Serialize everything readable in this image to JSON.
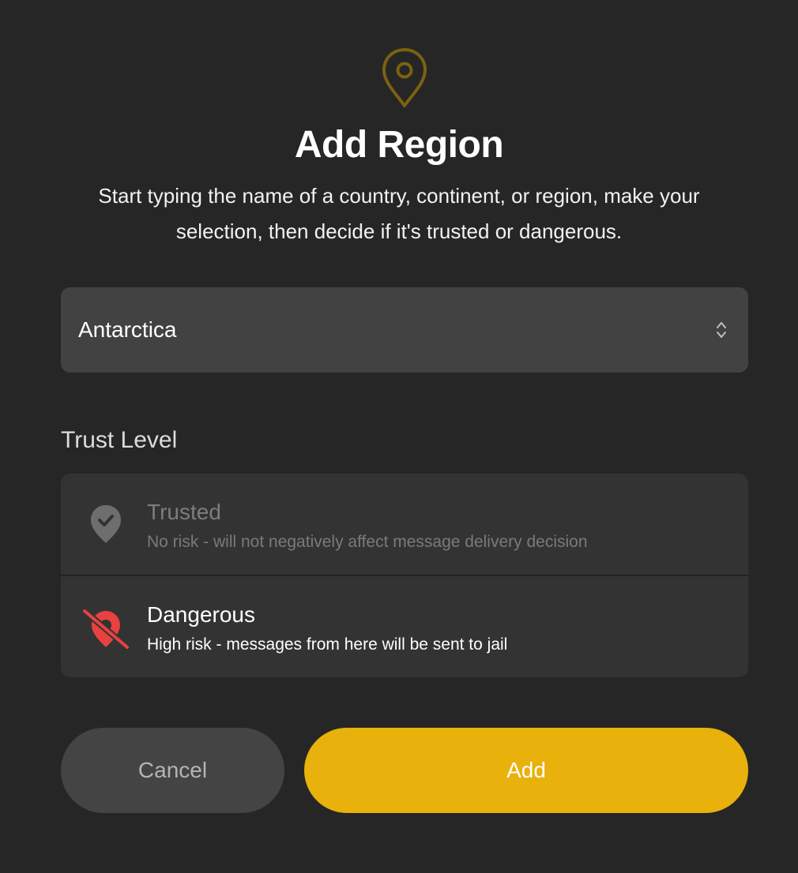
{
  "header": {
    "icon": "map-pin-icon",
    "title": "Add Region",
    "description": "Start typing the name of a country, continent, or region, make your selection, then decide if it's trusted or dangerous."
  },
  "region_select": {
    "value": "Antarctica",
    "icon": "chevron-up-down-icon"
  },
  "trust_level": {
    "label": "Trust Level",
    "selected": "Dangerous",
    "options": [
      {
        "title": "Trusted",
        "subtitle": "No risk - will not negatively affect message delivery decision",
        "icon": "location-check-icon"
      },
      {
        "title": "Dangerous",
        "subtitle": "High risk - messages from here will be sent to jail",
        "icon": "location-off-icon"
      }
    ]
  },
  "actions": {
    "cancel_label": "Cancel",
    "add_label": "Add"
  },
  "colors": {
    "background": "#262626",
    "accent": "#e8b10c",
    "danger": "#e8413f",
    "pin_outline": "#8a6d10"
  }
}
